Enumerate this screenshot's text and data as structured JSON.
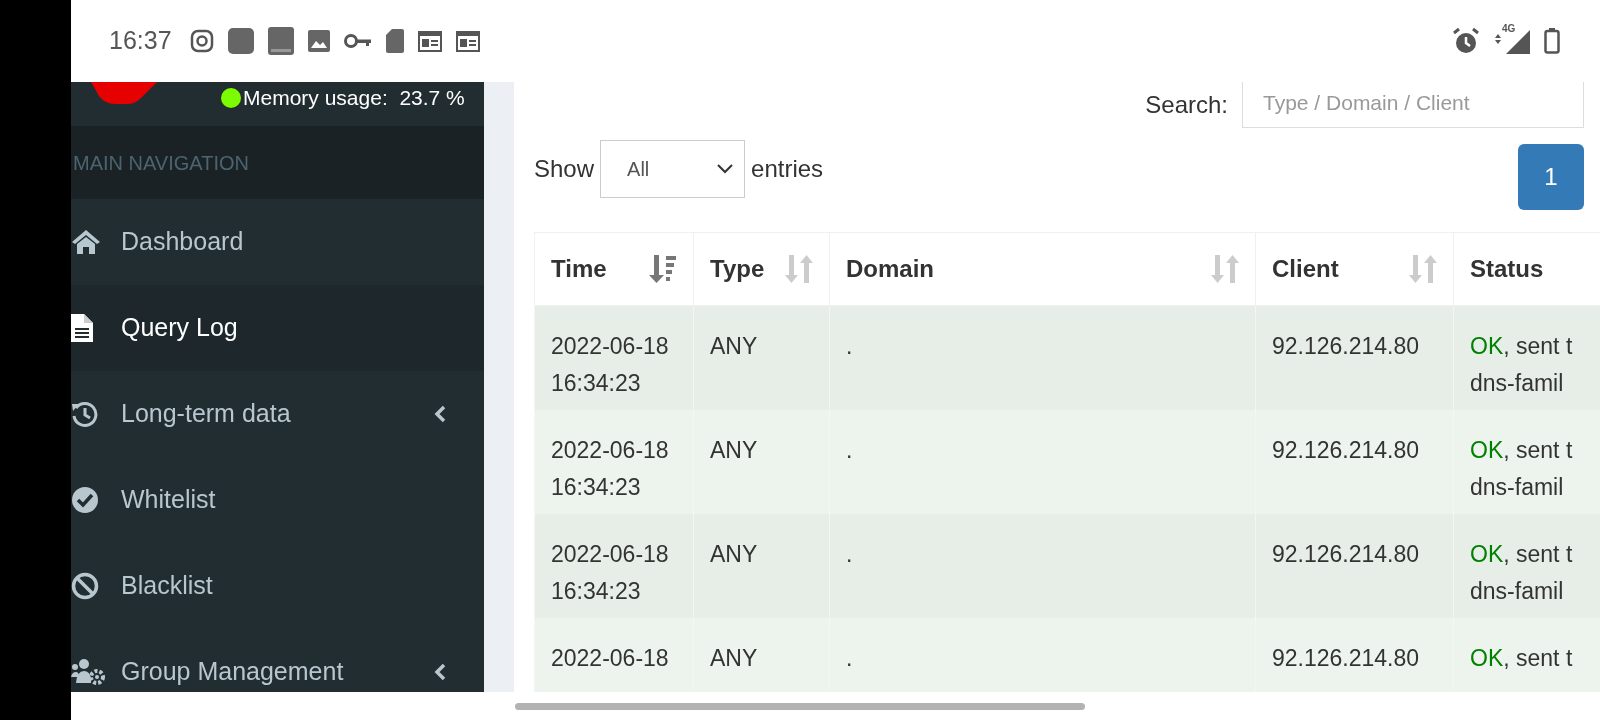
{
  "status_bar": {
    "time": "16:37",
    "network": "4G"
  },
  "sidebar": {
    "memory_usage": "Memory usage:  23.7 %",
    "header": "MAIN NAVIGATION",
    "items": [
      {
        "label": "Dashboard",
        "kind": "home",
        "selected": false,
        "has_submenu": false
      },
      {
        "label": "Query Log",
        "kind": "file",
        "selected": true,
        "has_submenu": false
      },
      {
        "label": "Long-term data",
        "kind": "history",
        "selected": false,
        "has_submenu": true
      },
      {
        "label": "Whitelist",
        "kind": "check",
        "selected": false,
        "has_submenu": false
      },
      {
        "label": "Blacklist",
        "kind": "ban",
        "selected": false,
        "has_submenu": false
      },
      {
        "label": "Group Management",
        "kind": "group",
        "selected": false,
        "has_submenu": true
      }
    ]
  },
  "search": {
    "label": "Search:",
    "placeholder": "Type / Domain / Client"
  },
  "length": {
    "label_before": "Show",
    "value": "All",
    "label_after": "entries"
  },
  "pagination": [
    {
      "label": "1",
      "selected": true
    }
  ],
  "table": {
    "columns": [
      {
        "label": "Time",
        "sorted": true
      },
      {
        "label": "Type",
        "sorted": false
      },
      {
        "label": "Domain",
        "sorted": false
      },
      {
        "label": "Client",
        "sorted": false
      },
      {
        "label": "Status"
      }
    ],
    "rows": [
      {
        "time": "2022-06-18 16:34:23",
        "type": "ANY",
        "domain": ".",
        "client": "92.126.214.80",
        "status_code": "OK",
        "status_text": ", sent t",
        "status_detail": "dns-famil"
      },
      {
        "time": "2022-06-18 16:34:23",
        "type": "ANY",
        "domain": ".",
        "client": "92.126.214.80",
        "status_code": "OK",
        "status_text": ", sent t",
        "status_detail": "dns-famil"
      },
      {
        "time": "2022-06-18 16:34:23",
        "type": "ANY",
        "domain": ".",
        "client": "92.126.214.80",
        "status_code": "OK",
        "status_text": ", sent t",
        "status_detail": "dns-famil"
      },
      {
        "time": "2022-06-18",
        "type": "ANY",
        "domain": ".",
        "client": "92.126.214.80",
        "status_code": "OK",
        "status_text": ", sent t"
      }
    ]
  }
}
